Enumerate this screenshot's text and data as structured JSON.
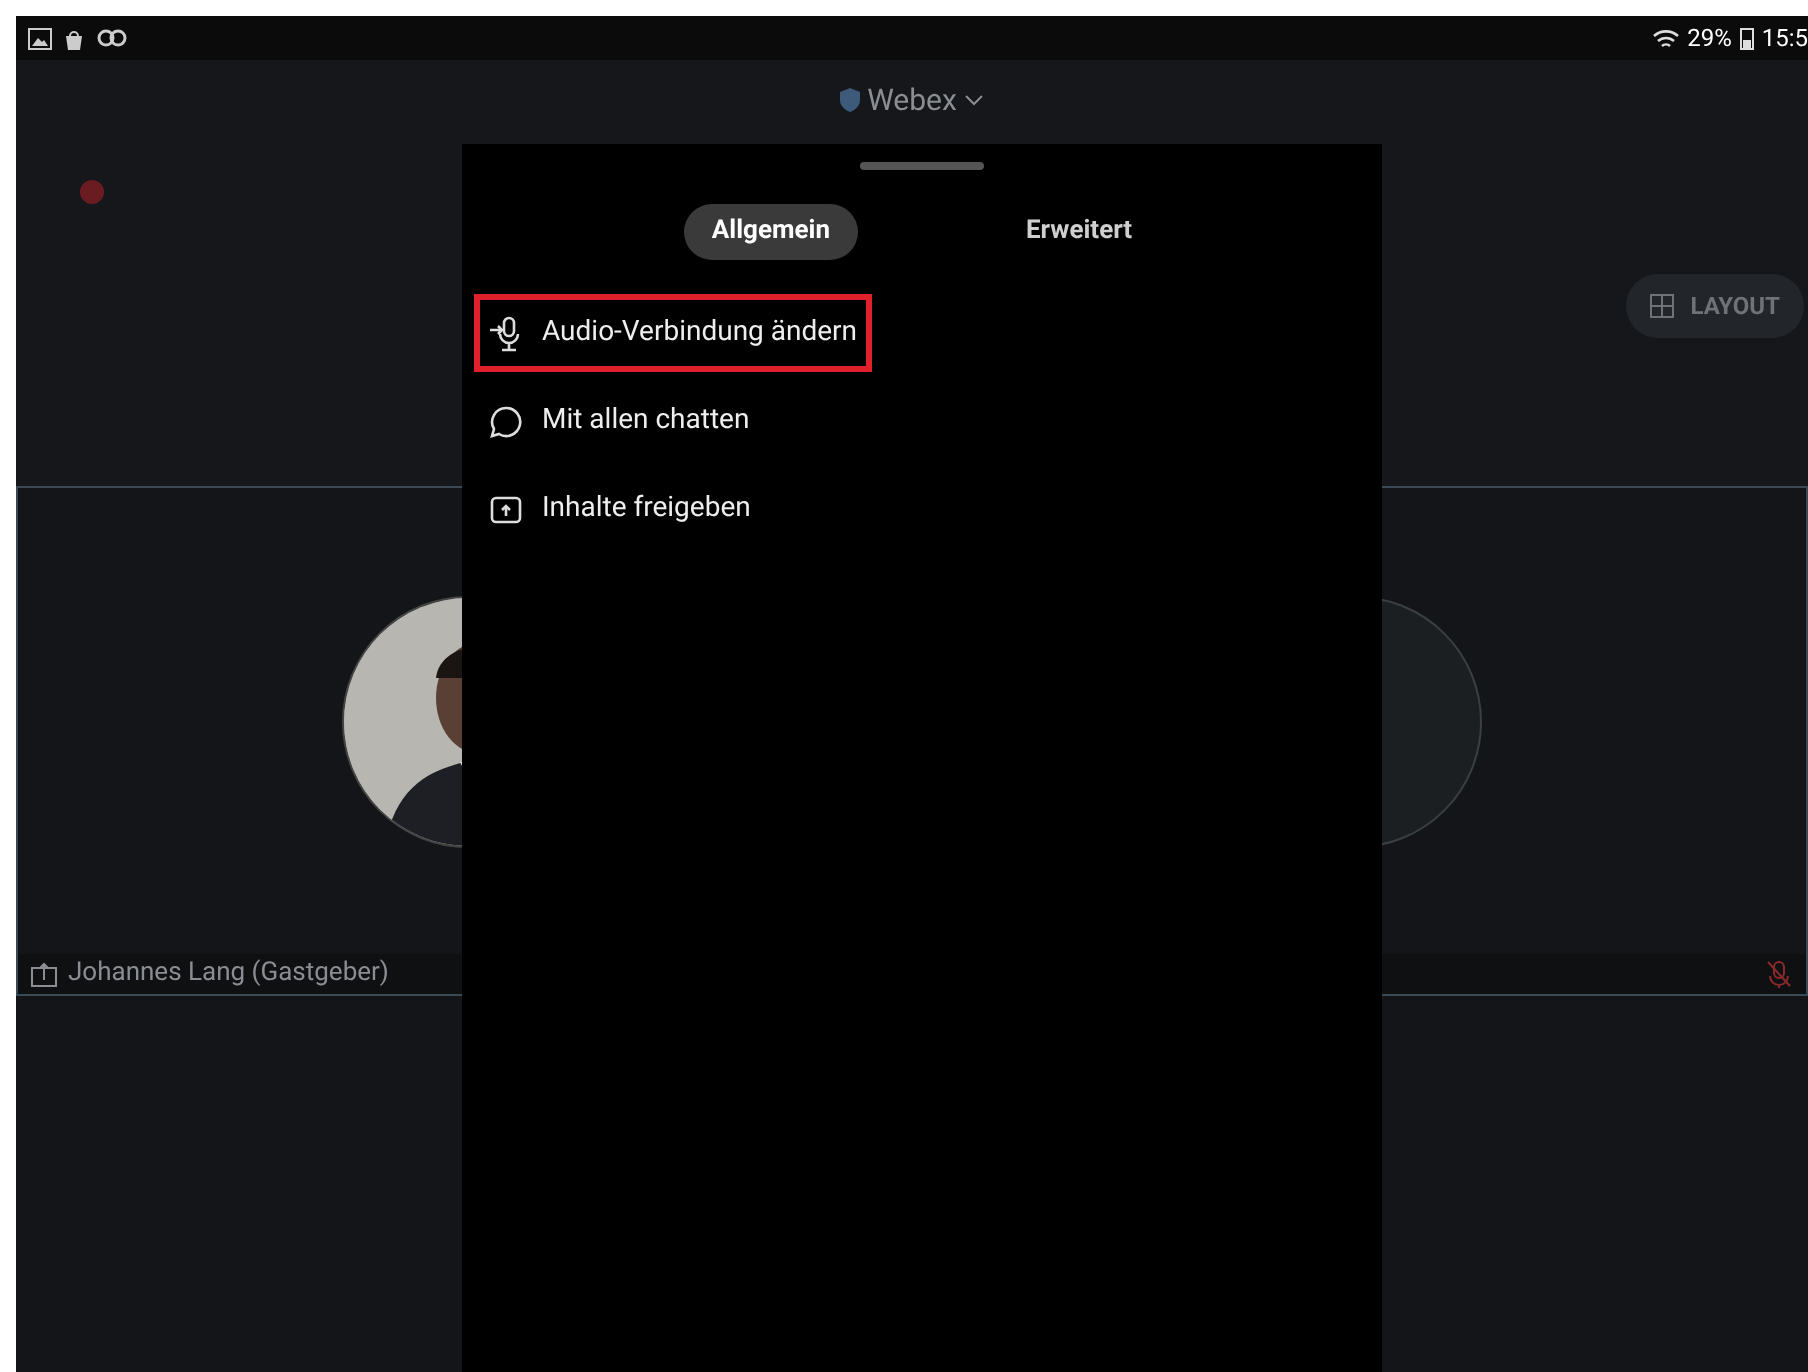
{
  "status_bar": {
    "battery": "29%",
    "time": "15:5"
  },
  "header": {
    "title": "Webex"
  },
  "layout_button": {
    "label": "LAYOUT"
  },
  "participant": {
    "name": "Johannes Lang (Gastgeber)",
    "muted": true
  },
  "sheet": {
    "tabs": [
      {
        "label": "Allgemein",
        "selected": true
      },
      {
        "label": "Erweitert",
        "selected": false
      }
    ],
    "items": [
      {
        "label": "Audio-Verbindung ändern",
        "kind": "audio",
        "highlighted": true
      },
      {
        "label": "Mit allen chatten",
        "kind": "chat",
        "highlighted": false
      },
      {
        "label": "Inhalte freigeben",
        "kind": "share",
        "highlighted": false
      }
    ]
  }
}
